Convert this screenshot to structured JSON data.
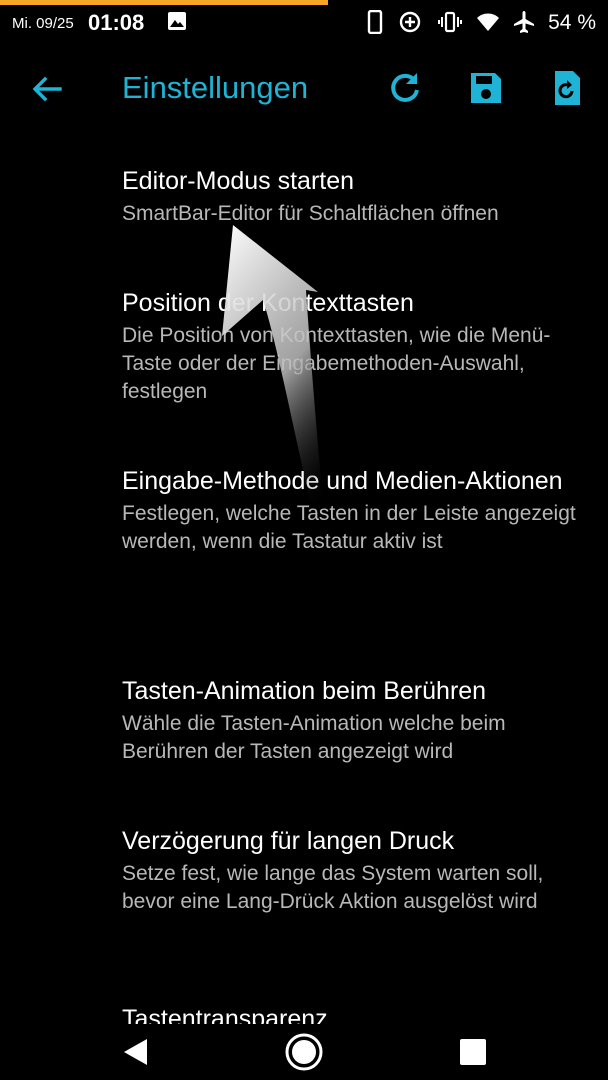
{
  "status": {
    "date": "Mi. 09/25",
    "time": "01:08",
    "battery": "54 %"
  },
  "toolbar": {
    "title": "Einstellungen"
  },
  "colors": {
    "accent": "#1fb3d6",
    "progress": "#f5a623",
    "subtitle": "#b8b8b8"
  },
  "icons": {
    "back": "arrow-left-icon",
    "refresh": "refresh-icon",
    "save": "save-icon",
    "restore": "restore-icon"
  },
  "settings": [
    {
      "title": "Editor-Modus starten",
      "subtitle": "SmartBar-Editor für Schaltflächen öffnen"
    },
    {
      "title": "Position der Kontexttasten",
      "subtitle": "Die Position von Kontexttasten, wie die Menü-Taste oder der Eingabemethoden-Auswahl, festlegen"
    },
    {
      "title": "Eingabe-Methode und Medien-Aktionen",
      "subtitle": "Festlegen, welche Tasten in der Leiste angezeigt werden, wenn die Tastatur aktiv ist"
    },
    {
      "title": "Tasten-Animation beim Berühren",
      "subtitle": "Wähle die Tasten-Animation welche beim Berühren der Tasten angezeigt wird"
    },
    {
      "title": "Verzögerung für langen Druck",
      "subtitle": "Setze fest, wie lange das System warten soll, bevor eine Lang-Drück Aktion ausgelöst wird"
    },
    {
      "title": "Tastentransparenz",
      "subtitle": ""
    }
  ]
}
